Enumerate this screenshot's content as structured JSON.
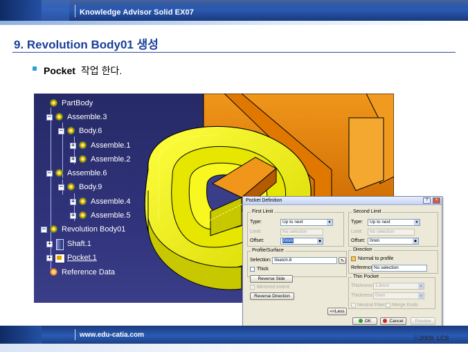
{
  "header": {
    "title": "Knowledge Advisor Solid EX07"
  },
  "slide": {
    "heading": "9. Revolution Body01 생성",
    "bullet_strong": "Pocket",
    "bullet_rest": "작업 한다."
  },
  "tree": {
    "items": [
      {
        "label": "PartBody",
        "icon": "gear-icon"
      },
      {
        "label": "Assemble.3",
        "icon": "gear-icon"
      },
      {
        "label": "Body.6",
        "icon": "gear-icon"
      },
      {
        "label": "Assemble.1",
        "icon": "gear-icon"
      },
      {
        "label": "Assemble.2",
        "icon": "gear-icon"
      },
      {
        "label": "Assemble.6",
        "icon": "gear-icon"
      },
      {
        "label": "Body.9",
        "icon": "gear-icon"
      },
      {
        "label": "Assemble.4",
        "icon": "gear-icon"
      },
      {
        "label": "Assemble.5",
        "icon": "gear-icon"
      },
      {
        "label": "Revolution Body01",
        "icon": "gear-icon"
      },
      {
        "label": "Shaft.1",
        "icon": "shaft-icon"
      },
      {
        "label": "Pocket.1",
        "icon": "pocket-icon"
      },
      {
        "label": "Reference Data",
        "icon": "reference-icon"
      }
    ]
  },
  "dialog": {
    "title": "Pocket Definition",
    "help_label": "?",
    "close_label": "×",
    "first_limit": {
      "legend": "First Limit",
      "type_label": "Type:",
      "type_value": "Up to next",
      "limit_label": "Limit:",
      "limit_value": "No selection",
      "offset_label": "Offset:",
      "offset_value": "0mm"
    },
    "profile": {
      "legend": "Profile/Surface",
      "selection_label": "Selection:",
      "selection_value": "Sketch.8",
      "thick_label": "Thick"
    },
    "reverse_side_label": "Reverse Side",
    "mirrored_extent_label": "Mirrored extent",
    "reverse_direction_label": "Reverse Direction",
    "less_label": "<<Less",
    "second_limit": {
      "legend": "Second Limit",
      "type_label": "Type:",
      "type_value": "Up to next",
      "limit_label": "Limit:",
      "limit_value": "No selection",
      "offset_label": "Offset:",
      "offset_value": "0mm"
    },
    "direction": {
      "legend": "Direction",
      "normal_label": "Normal to profile",
      "reference_label": "Reference:",
      "reference_value": "No selection"
    },
    "thin": {
      "legend": "Thin Pocket",
      "thickness1_label": "Thickness1:",
      "thickness1_value": "1.6mm",
      "thickness2_label": "Thickness2:",
      "thickness2_value": "0mm",
      "neutral_label": "Neutral Fiber",
      "merge_label": "Merge Ends"
    },
    "ok_label": "OK",
    "cancel_label": "Cancel",
    "preview_label": "Preview"
  },
  "footer": {
    "url": "www.edu-catia.com",
    "copyright": "ⓒ2009. LCS"
  },
  "colors": {
    "brand_blue": "#1a3e9a",
    "part_yellow": "#f0f000",
    "part_orange": "#e87a00",
    "viewport_bg": "#2c3072"
  }
}
